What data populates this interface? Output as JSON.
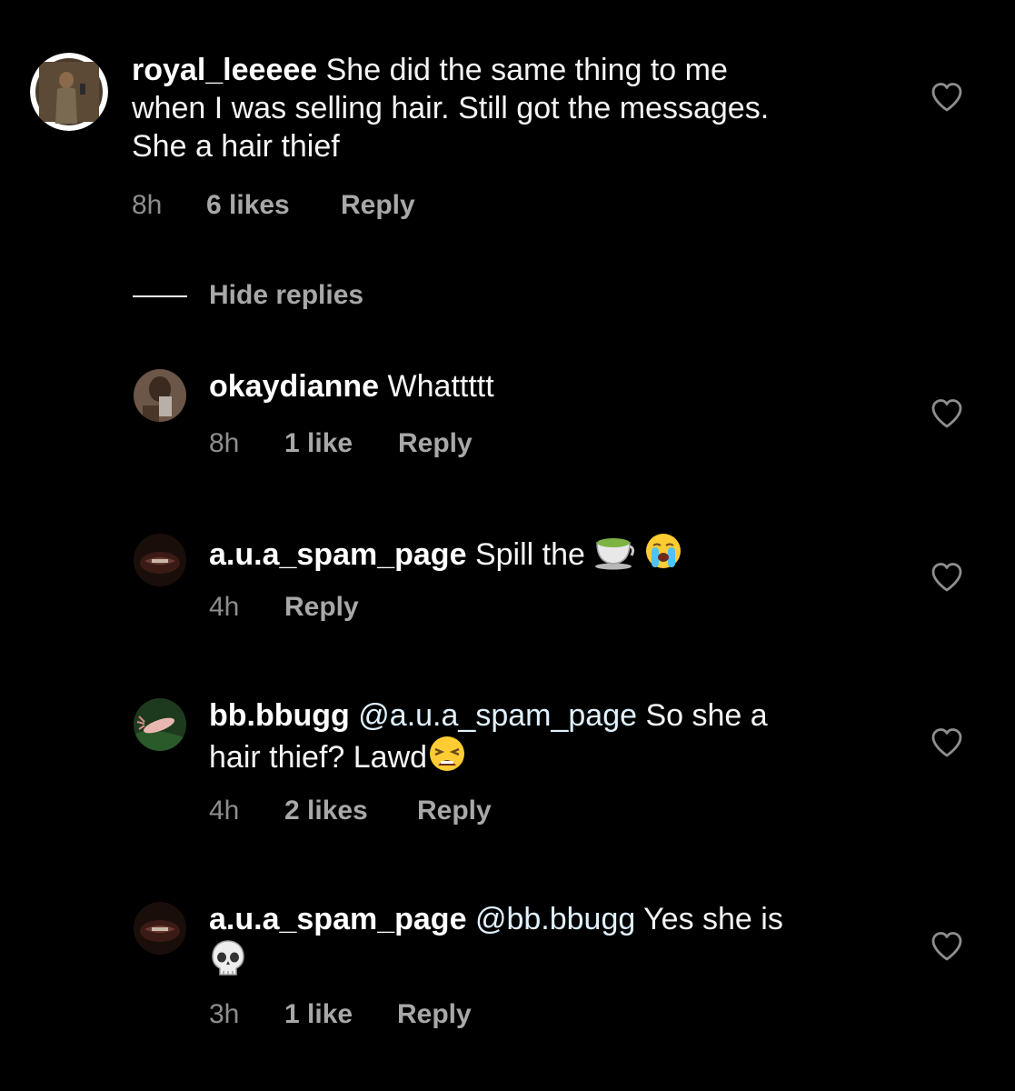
{
  "comments": [
    {
      "username": "royal_leeeee",
      "text_lines": [
        "She did the same thing to me",
        "when I was selling hair. Still got the messages.",
        "She a hair thief"
      ],
      "time": "8h",
      "likes": "6 likes",
      "reply": "Reply"
    },
    {
      "username": "okaydianne",
      "text": "Whattttt",
      "time": "8h",
      "likes": "1 like",
      "reply": "Reply"
    },
    {
      "username": "a.u.a_spam_page",
      "text": "Spill the",
      "emojis": [
        "teacup-emoji",
        "loudly-crying-face-emoji"
      ],
      "time": "4h",
      "reply": "Reply"
    },
    {
      "username": "bb.bbugg",
      "mention": "@a.u.a_spam_page",
      "text_line1": "So she a",
      "text_line2": "hair thief? Lawd",
      "emojis": [
        "weary-face-emoji"
      ],
      "time": "4h",
      "likes": "2 likes",
      "reply": "Reply"
    },
    {
      "username": "a.u.a_spam_page",
      "mention": "@bb.bbugg",
      "text": "Yes she is",
      "emojis": [
        "skull-emoji"
      ],
      "time": "3h",
      "likes": "1 like",
      "reply": "Reply"
    }
  ],
  "hide_replies_label": "Hide replies",
  "icons": {
    "like": "heart-outline-icon"
  },
  "colors": {
    "background": "#000000",
    "text": "#ffffff",
    "meta": "#8e8e8e",
    "mention": "#e0f1ff"
  }
}
